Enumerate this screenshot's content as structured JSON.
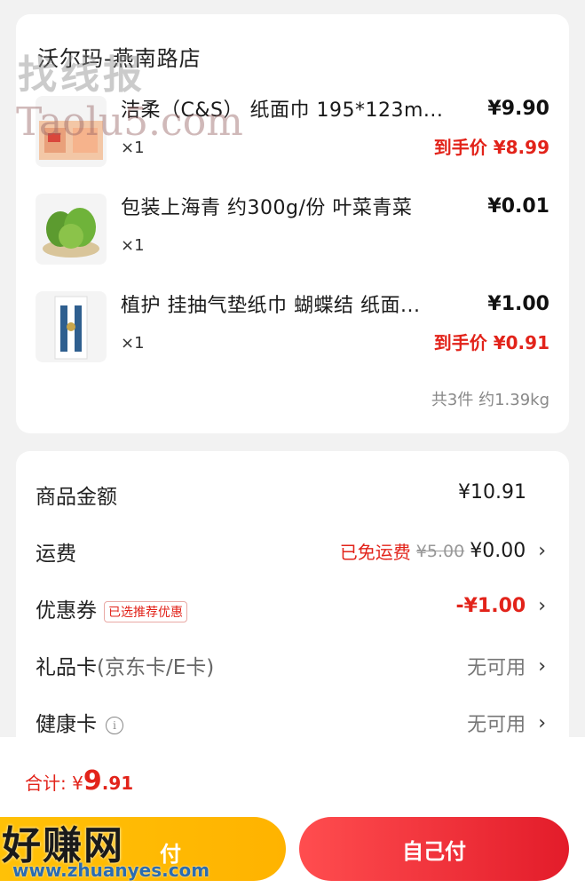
{
  "store": {
    "name": "沃尔玛-燕南路店",
    "items": [
      {
        "title": "洁柔（C&S） 纸面巾 195*123m...",
        "qty": "×1",
        "price": "¥9.90",
        "final_price": "到手价 ¥8.99"
      },
      {
        "title": "包装上海青 约300g/份 叶菜青菜",
        "qty": "×1",
        "price": "¥0.01",
        "final_price": ""
      },
      {
        "title": "植护 挂抽气垫纸巾 蝴蝶结 纸面...",
        "qty": "×1",
        "price": "¥1.00",
        "final_price": "到手价 ¥0.91"
      }
    ],
    "summary": "共3件 约1.39kg"
  },
  "fees": {
    "goods": {
      "label": "商品金额",
      "value": "¥10.91"
    },
    "shipping": {
      "label": "运费",
      "free_text": "已免运费",
      "original": "¥5.00",
      "value": "¥0.00"
    },
    "coupon": {
      "label": "优惠券",
      "tag": "已选推荐优惠",
      "value": "-¥1.00"
    },
    "giftcard": {
      "label": "礼品卡",
      "sub": "(京东卡/E卡)",
      "value": "无可用"
    },
    "healthcard": {
      "label": "健康卡",
      "value": "无可用"
    }
  },
  "bottom": {
    "total_label": "合计:",
    "currency": "¥",
    "total_int": "9",
    "total_dec": ".91",
    "friend_pay": "付",
    "self_pay": "自己付"
  },
  "watermarks": {
    "top_cn": "找线报",
    "top_en": "Taolu5.com",
    "bottom_cn": "好赚网",
    "bottom_en": "www.zhuanyes.com"
  },
  "colors": {
    "accent_red": "#e2231a",
    "friend_button": "#ffc107",
    "self_button": "#ff4d4f"
  }
}
